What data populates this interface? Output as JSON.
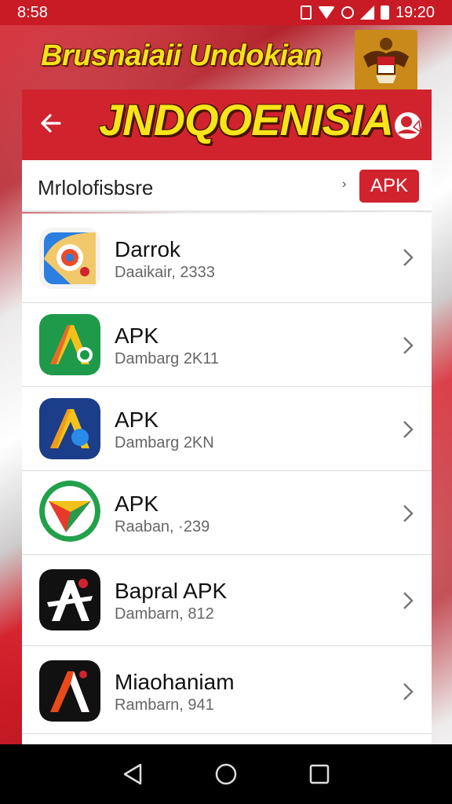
{
  "status_bar": {
    "time": "8:58",
    "right_time": "19:20"
  },
  "banner": {
    "title": "Brusnaiaii Undokian"
  },
  "app_bar": {
    "title": "JNDQOENISIA"
  },
  "search": {
    "text": "Mrlolofisbsre",
    "badge": "APK"
  },
  "items": [
    {
      "title": "Darrok",
      "subtitle": "Daaikair, 2333",
      "icon": "camera-lens-app-icon"
    },
    {
      "title": "APK",
      "subtitle": "Dambarg 2K11",
      "icon": "green-a-app-icon"
    },
    {
      "title": "APK",
      "subtitle": "Dambarg 2KN",
      "icon": "blue-a-app-icon"
    },
    {
      "title": "APK",
      "subtitle": "Raaban, ·239",
      "icon": "green-kite-app-icon"
    },
    {
      "title": "Bapral APK",
      "subtitle": "Dambarn, 812",
      "icon": "black-star-app-icon"
    },
    {
      "title": "Miaohaniam",
      "subtitle": "Rambarn, 941",
      "icon": "black-red-a-app-icon"
    }
  ],
  "colors": {
    "brand_red": "#d0232e",
    "title_yellow": "#f7e41a",
    "nav_black": "#000000"
  }
}
